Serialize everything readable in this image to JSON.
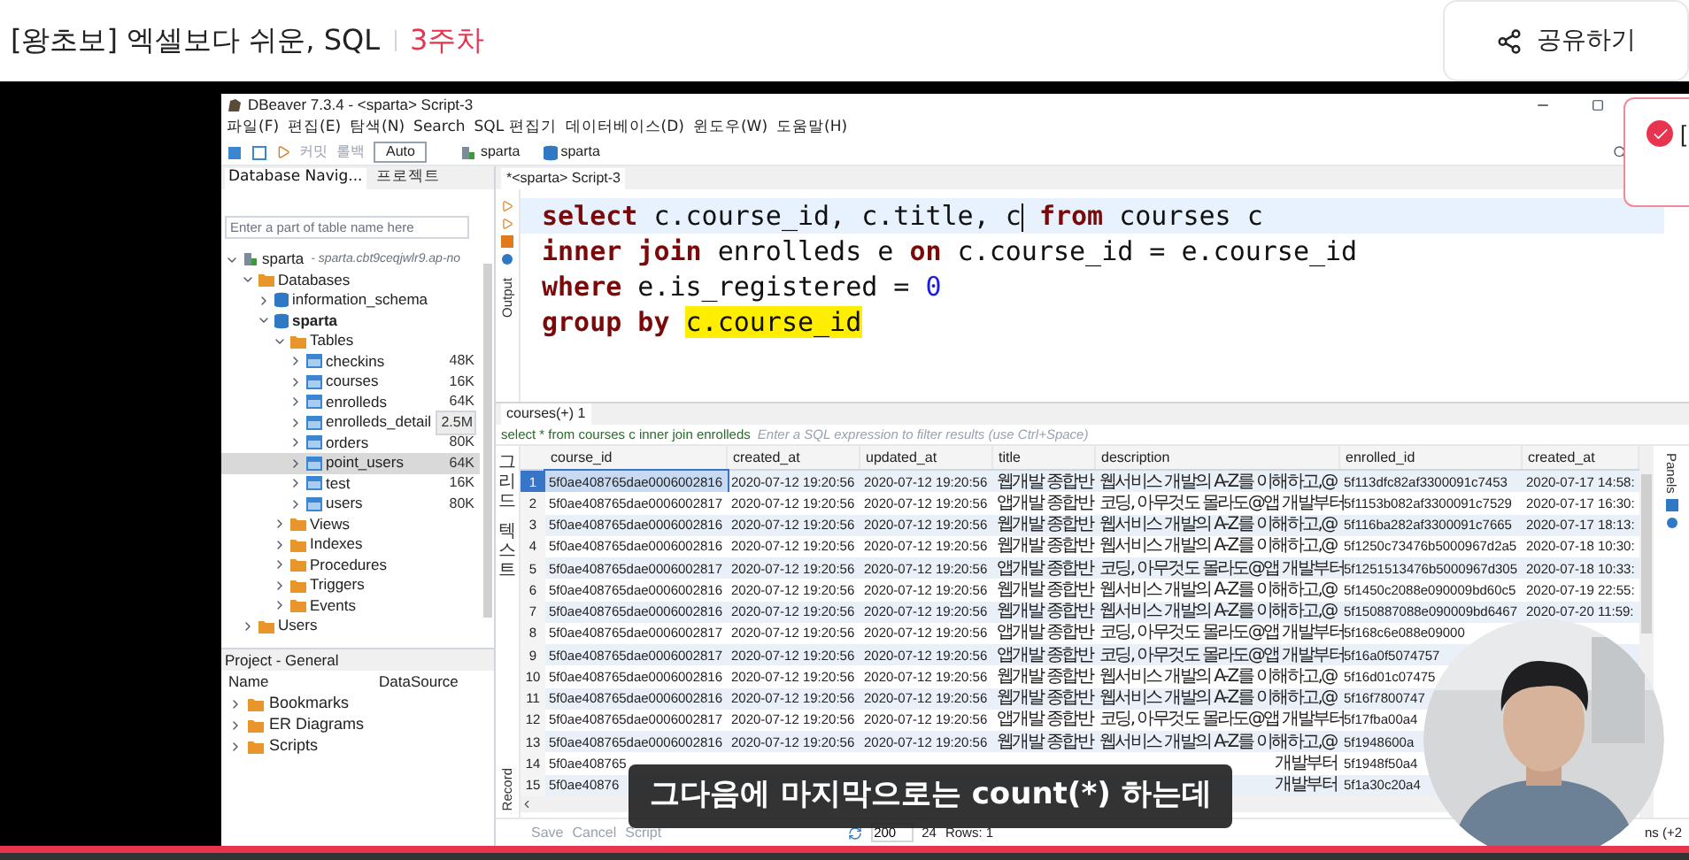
{
  "page": {
    "title": "[왕초보] 엑셀보다 쉬운, SQL",
    "week": "3주차",
    "share_button": "공유하기"
  },
  "toast": {
    "text": "["
  },
  "dbeaver": {
    "title": "DBeaver 7.3.4 - <sparta> Script-3",
    "menu": [
      "파일(F)",
      "편집(E)",
      "탐색(N)",
      "Search",
      "SQL 편집기",
      "데이터베이스(D)",
      "윈도우(W)",
      "도움말(H)"
    ],
    "toolbar": {
      "buttons": [
        {
          "label": "커밋",
          "disabled": true
        },
        {
          "label": "롤백",
          "disabled": true
        }
      ],
      "mode": "Auto",
      "connection": "sparta",
      "database": "sparta"
    }
  },
  "navigator": {
    "tabs": [
      {
        "label": "Database Navig...",
        "selected": true
      },
      {
        "label": "프로젝트",
        "selected": false
      }
    ],
    "filter": {
      "placeholder": "Enter a part of table name here"
    },
    "tree": [
      {
        "label": "sparta",
        "kind": "connection",
        "detail": "- sparta.cbt9ceqjwlr9.ap-no",
        "expanded": true,
        "children": [
          {
            "label": "Databases",
            "kind": "folder",
            "expanded": true,
            "children": [
              {
                "label": "information_schema",
                "kind": "database",
                "active": false,
                "expanded": false
              },
              {
                "label": "sparta",
                "kind": "database",
                "active": true,
                "expanded": true,
                "children": [
                  {
                    "label": "Tables",
                    "kind": "folder",
                    "expanded": true,
                    "children": [
                      {
                        "label": "checkins",
                        "kind": "table",
                        "size": "48K",
                        "selected": false,
                        "hovered": false,
                        "expanded": false
                      },
                      {
                        "label": "courses",
                        "kind": "table",
                        "size": "16K",
                        "selected": false,
                        "hovered": false,
                        "expanded": false
                      },
                      {
                        "label": "enrolleds",
                        "kind": "table",
                        "size": "64K",
                        "selected": false,
                        "hovered": false,
                        "expanded": false
                      },
                      {
                        "label": "enrolleds_detail",
                        "kind": "table",
                        "size": "2.5M",
                        "selected": false,
                        "hovered": true,
                        "expanded": false
                      },
                      {
                        "label": "orders",
                        "kind": "table",
                        "size": "80K",
                        "selected": false,
                        "hovered": false,
                        "expanded": false
                      },
                      {
                        "label": "point_users",
                        "kind": "table",
                        "size": "64K",
                        "selected": true,
                        "hovered": false,
                        "expanded": false
                      },
                      {
                        "label": "test",
                        "kind": "table",
                        "size": "16K",
                        "selected": false,
                        "hovered": false,
                        "expanded": false
                      },
                      {
                        "label": "users",
                        "kind": "table",
                        "size": "80K",
                        "selected": false,
                        "hovered": false,
                        "expanded": false
                      }
                    ]
                  },
                  {
                    "label": "Views",
                    "kind": "folder",
                    "expanded": false
                  },
                  {
                    "label": "Indexes",
                    "kind": "folder",
                    "expanded": false
                  },
                  {
                    "label": "Procedures",
                    "kind": "folder",
                    "expanded": false
                  },
                  {
                    "label": "Triggers",
                    "kind": "folder",
                    "expanded": false
                  },
                  {
                    "label": "Events",
                    "kind": "folder",
                    "expanded": false
                  }
                ]
              }
            ]
          },
          {
            "label": "Users",
            "kind": "folder",
            "expanded": false
          }
        ]
      }
    ]
  },
  "project": {
    "title": "Project - General",
    "columns": [
      "Name",
      "DataSource"
    ],
    "items": [
      "Bookmarks",
      "ER Diagrams",
      "Scripts"
    ]
  },
  "editor": {
    "tab": "*<sparta> Script-3",
    "output_label": "Output",
    "lines": [
      {
        "current": true,
        "tokens": [
          {
            "kind": "keyword",
            "text": "select"
          },
          {
            "kind": "plain",
            "text": " c.course_id, c.title, c"
          },
          {
            "kind": "caret"
          },
          {
            "kind": "keyword",
            "text": "from"
          },
          {
            "kind": "plain",
            "text": " courses c"
          }
        ]
      },
      {
        "current": false,
        "tokens": [
          {
            "kind": "keyword",
            "text": "inner join"
          },
          {
            "kind": "plain",
            "text": " enrolleds e "
          },
          {
            "kind": "keyword",
            "text": "on"
          },
          {
            "kind": "plain",
            "text": " c.course_id = e.course_id"
          }
        ]
      },
      {
        "current": false,
        "tokens": [
          {
            "kind": "keyword",
            "text": "where"
          },
          {
            "kind": "plain",
            "text": " e.is_registered = "
          },
          {
            "kind": "number",
            "text": "0"
          }
        ]
      },
      {
        "current": false,
        "tokens": [
          {
            "kind": "keyword",
            "text": "group by"
          },
          {
            "kind": "highlight",
            "text": "c.course_id"
          }
        ]
      }
    ]
  },
  "results": {
    "tab": "courses(+) 1",
    "query": "select * from courses c inner join enrolleds",
    "filter_placeholder": "Enter a SQL expression to filter results (use Ctrl+Space)",
    "view_labels": [
      "그리드",
      "텍스트"
    ],
    "record_label": "Record",
    "panels_label": "Panels",
    "columns": [
      "course_id",
      "created_at",
      "updated_at",
      "title",
      "description",
      "enrolled_id",
      "created_at"
    ],
    "rows": [
      {
        "number": "1",
        "selected": true,
        "covered": false,
        "cells": [
          "5f0ae408765dae0006002816",
          "2020-07-12 19:20:56",
          "2020-07-12 19:20:56",
          "웹개발 종합반",
          "웹서비스 개발의 A-Z를 이해하고,@",
          "5f113dfc82af3300091c7453",
          "2020-07-17 14:58:"
        ]
      },
      {
        "number": "2",
        "selected": false,
        "covered": false,
        "cells": [
          "5f0ae408765dae0006002817",
          "2020-07-12 19:20:56",
          "2020-07-12 19:20:56",
          "앱개발 종합반",
          "코딩, 아무것도 몰라도@앱 개발부터",
          "5f1153b082af3300091c7529",
          "2020-07-17 16:30:"
        ]
      },
      {
        "number": "3",
        "selected": false,
        "covered": false,
        "cells": [
          "5f0ae408765dae0006002816",
          "2020-07-12 19:20:56",
          "2020-07-12 19:20:56",
          "웹개발 종합반",
          "웹서비스 개발의 A-Z를 이해하고,@",
          "5f116ba282af3300091c7665",
          "2020-07-17 18:13:"
        ]
      },
      {
        "number": "4",
        "selected": false,
        "covered": false,
        "cells": [
          "5f0ae408765dae0006002816",
          "2020-07-12 19:20:56",
          "2020-07-12 19:20:56",
          "웹개발 종합반",
          "웹서비스 개발의 A-Z를 이해하고,@",
          "5f1250c73476b5000967d2a5",
          "2020-07-18 10:30:"
        ]
      },
      {
        "number": "5",
        "selected": false,
        "covered": false,
        "cells": [
          "5f0ae408765dae0006002817",
          "2020-07-12 19:20:56",
          "2020-07-12 19:20:56",
          "앱개발 종합반",
          "코딩, 아무것도 몰라도@앱 개발부터",
          "5f1251513476b5000967d305",
          "2020-07-18 10:33:"
        ]
      },
      {
        "number": "6",
        "selected": false,
        "covered": false,
        "cells": [
          "5f0ae408765dae0006002816",
          "2020-07-12 19:20:56",
          "2020-07-12 19:20:56",
          "웹개발 종합반",
          "웹서비스 개발의 A-Z를 이해하고,@",
          "5f1450c2088e090009bd60c5",
          "2020-07-19 22:55:"
        ]
      },
      {
        "number": "7",
        "selected": false,
        "covered": false,
        "cells": [
          "5f0ae408765dae0006002816",
          "2020-07-12 19:20:56",
          "2020-07-12 19:20:56",
          "웹개발 종합반",
          "웹서비스 개발의 A-Z를 이해하고,@",
          "5f150887088e090009bd6467",
          "2020-07-20 11:59:"
        ]
      },
      {
        "number": "8",
        "selected": false,
        "covered": false,
        "cells": [
          "5f0ae408765dae0006002817",
          "2020-07-12 19:20:56",
          "2020-07-12 19:20:56",
          "앱개발 종합반",
          "코딩, 아무것도 몰라도@앱 개발부터",
          "5f168c6e088e09000",
          null
        ]
      },
      {
        "number": "9",
        "selected": false,
        "covered": false,
        "cells": [
          "5f0ae408765dae0006002817",
          "2020-07-12 19:20:56",
          "2020-07-12 19:20:56",
          "앱개발 종합반",
          "코딩, 아무것도 몰라도@앱 개발부터",
          "5f16a0f5074757",
          null
        ]
      },
      {
        "number": "10",
        "selected": false,
        "covered": false,
        "cells": [
          "5f0ae408765dae0006002816",
          "2020-07-12 19:20:56",
          "2020-07-12 19:20:56",
          "웹개발 종합반",
          "웹서비스 개발의 A-Z를 이해하고,@",
          "5f16d01c07475",
          null
        ]
      },
      {
        "number": "11",
        "selected": false,
        "covered": false,
        "cells": [
          "5f0ae408765dae0006002816",
          "2020-07-12 19:20:56",
          "2020-07-12 19:20:56",
          "웹개발 종합반",
          "웹서비스 개발의 A-Z를 이해하고,@",
          "5f16f7800747",
          null
        ]
      },
      {
        "number": "12",
        "selected": false,
        "covered": false,
        "cells": [
          "5f0ae408765dae0006002817",
          "2020-07-12 19:20:56",
          "2020-07-12 19:20:56",
          "앱개발 종합반",
          "코딩, 아무것도 몰라도@앱 개발부터",
          "5f17fba00a4",
          null
        ]
      },
      {
        "number": "13",
        "selected": false,
        "covered": false,
        "cells": [
          "5f0ae408765dae0006002816",
          "2020-07-12 19:20:56",
          "2020-07-12 19:20:56",
          "웹개발 종합반",
          "웹서비스 개발의 A-Z를 이해하고,@",
          "5f1948600a",
          null
        ]
      },
      {
        "number": "14",
        "selected": false,
        "covered": true,
        "cells": [
          "5f0ae408765",
          null,
          null,
          null,
          "개발부터",
          "5f1948f50a4",
          null
        ]
      },
      {
        "number": "15",
        "selected": false,
        "covered": true,
        "cells": [
          "5f0ae40876",
          null,
          null,
          null,
          "개발부터",
          "5f1a30c20a4",
          null
        ]
      }
    ],
    "footer": {
      "buttons": [
        "Save",
        "Cancel",
        "Script"
      ],
      "fetch_size": "200",
      "refresh": "24",
      "rows": "Rows: 1",
      "tail": "ns (+2"
    }
  },
  "subtitle": "그다음에 마지막으로는 count(*) 하는데"
}
